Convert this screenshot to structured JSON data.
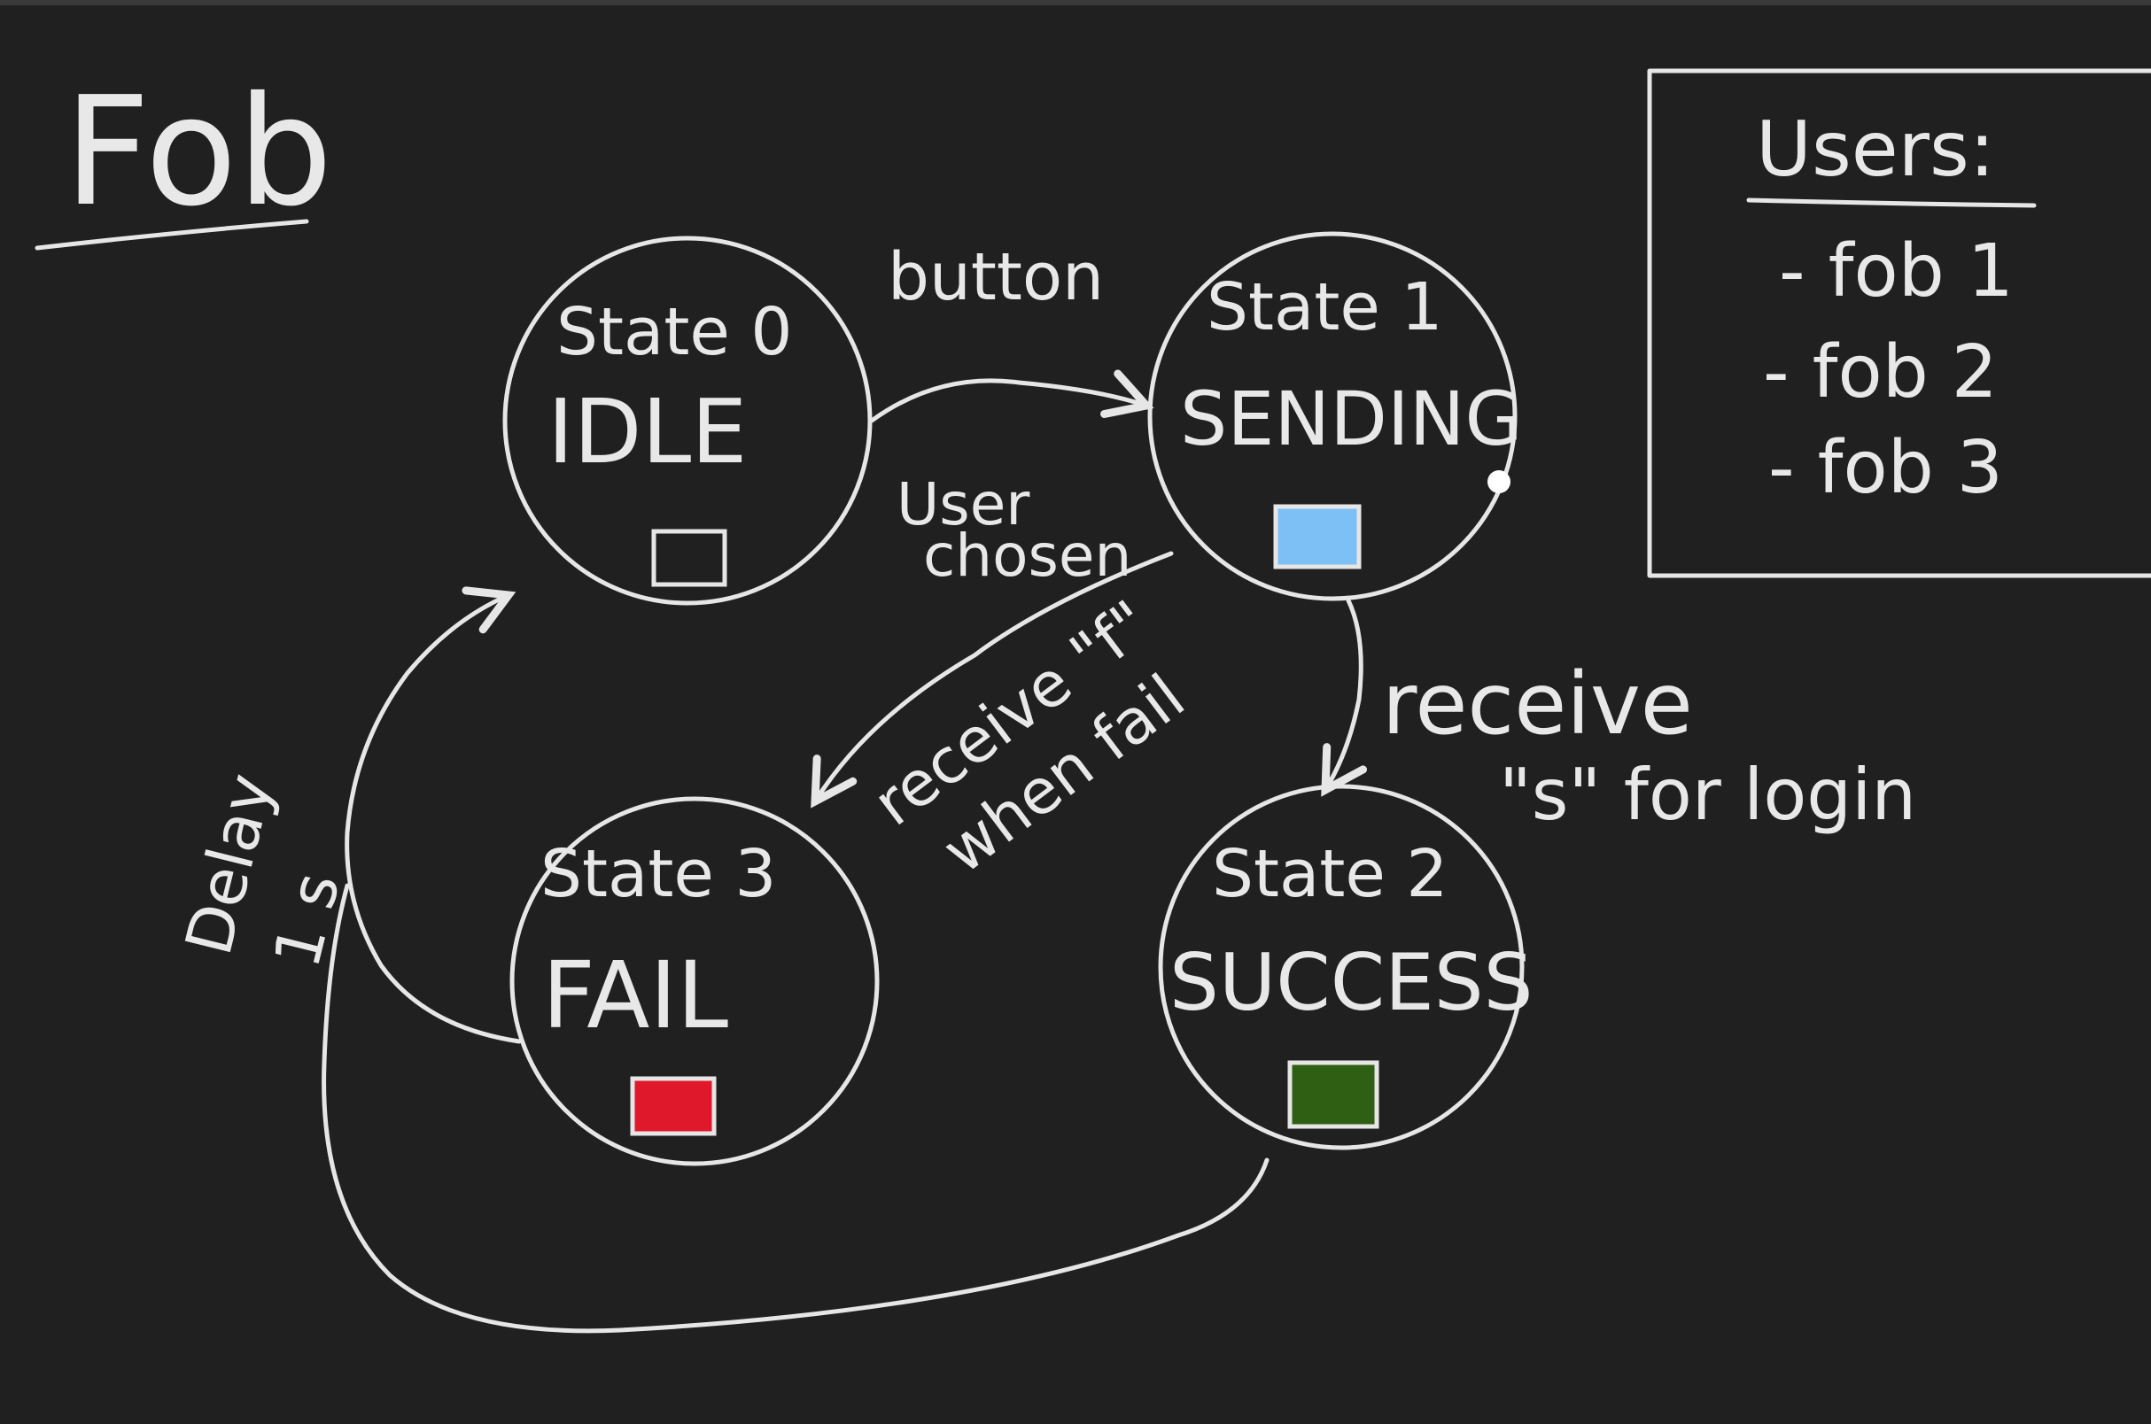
{
  "title": "Fob",
  "states": [
    {
      "id": "s0",
      "number_label": "State 0",
      "name": "IDLE",
      "indicator_color": "none"
    },
    {
      "id": "s1",
      "number_label": "State 1",
      "name": "SENDING",
      "indicator_color": "#7cc0f5"
    },
    {
      "id": "s2",
      "number_label": "State 2",
      "name": "SUCCESS",
      "indicator_color": "#2f5f12"
    },
    {
      "id": "s3",
      "number_label": "State 3",
      "name": "FAIL",
      "indicator_color": "#e0182c"
    }
  ],
  "transitions": {
    "idle_to_sending": "button",
    "user_chosen_line1": "User",
    "user_chosen_line2": "chosen",
    "sending_to_fail_line1": "receive \"f\"",
    "sending_to_fail_line2": "when fail",
    "sending_to_success_line1": "receive",
    "sending_to_success_line2": "\"s\" for login",
    "delay_line1": "Delay",
    "delay_line2": "1 s"
  },
  "users_box": {
    "heading": "Users:",
    "items": [
      "- fob 1",
      "- fob 2",
      "- fob 3"
    ]
  },
  "colors": {
    "background": "#202020",
    "ink": "#e6e6e6",
    "sending_indicator": "#7cc0f5",
    "success_indicator": "#2f5f12",
    "fail_indicator": "#e0182c"
  }
}
